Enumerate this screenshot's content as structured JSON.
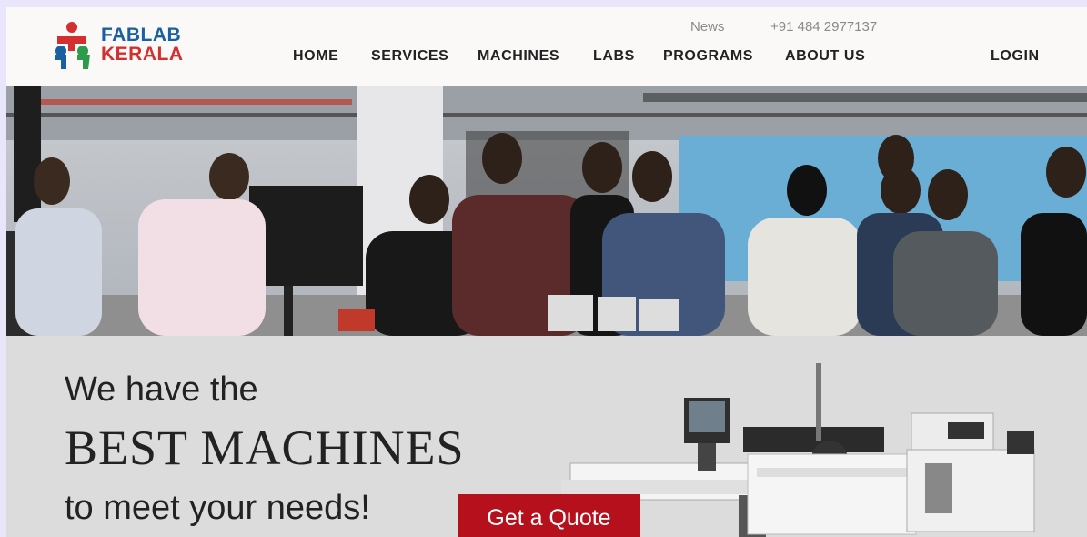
{
  "brand": {
    "line1": "FABLAB",
    "line2": "KERALA"
  },
  "topbar": {
    "news": "News",
    "phone": "+91 484 2977137"
  },
  "nav": [
    "HOME",
    "SERVICES",
    "MACHINES",
    "LABS",
    "PROGRAMS",
    "ABOUT US"
  ],
  "login": "LOGIN",
  "banner": {
    "line1": "We have the",
    "line2": "BEST MACHINES",
    "line3": "to meet your needs!",
    "cta": "Get a Quote"
  },
  "colors": {
    "accent": "#b5101b",
    "brand_blue": "#1a5fa0",
    "brand_red": "#d32f2f",
    "brand_green": "#2e9b4a"
  }
}
